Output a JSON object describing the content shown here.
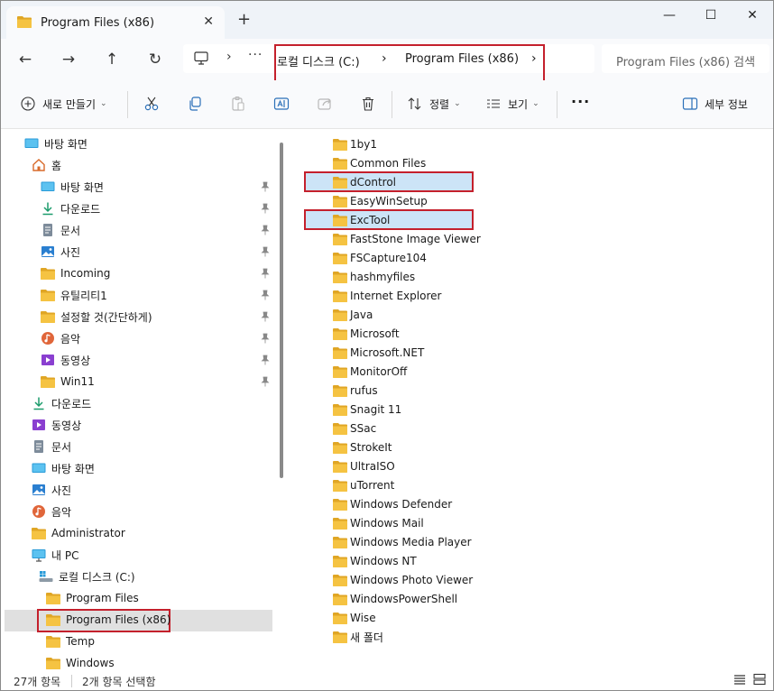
{
  "window": {
    "tab_title": "Program Files (x86)",
    "tab_close": "✕",
    "new_tab": "+",
    "minimize": "—",
    "maximize": "☐",
    "close": "✕"
  },
  "address": {
    "back": "←",
    "forward": "→",
    "up": "↑",
    "refresh": "↻",
    "sep": "›",
    "more": "···",
    "crumbs": [
      "로컬 디스크 (C:)",
      "Program Files (x86)"
    ],
    "search_placeholder": "Program Files (x86) 검색"
  },
  "toolbar": {
    "new_label": "새로 만들기",
    "sort_label": "정렬",
    "view_label": "보기",
    "more": "···",
    "details_label": "세부 정보",
    "icons": [
      "cut-icon",
      "copy-icon",
      "paste-icon",
      "rename-icon",
      "share-icon",
      "delete-icon"
    ]
  },
  "sidebar": {
    "items": [
      {
        "label": "바탕 화면",
        "icon": "desktop-icon"
      },
      {
        "label": "홈",
        "icon": "home-icon"
      },
      {
        "label": "바탕 화면",
        "icon": "desktop-icon",
        "pinned": true
      },
      {
        "label": "다운로드",
        "icon": "download-icon",
        "pinned": true
      },
      {
        "label": "문서",
        "icon": "document-icon",
        "pinned": true
      },
      {
        "label": "사진",
        "icon": "picture-icon",
        "pinned": true
      },
      {
        "label": "Incoming",
        "icon": "folder-icon",
        "pinned": true
      },
      {
        "label": "유틸리티1",
        "icon": "folder-icon",
        "pinned": true
      },
      {
        "label": "설정할 것(간단하게)",
        "icon": "folder-icon",
        "pinned": true
      },
      {
        "label": "음악",
        "icon": "music-icon",
        "pinned": true
      },
      {
        "label": "동영상",
        "icon": "video-icon",
        "pinned": true
      },
      {
        "label": "Win11",
        "icon": "folder-icon",
        "pinned": true
      },
      {
        "label": "다운로드",
        "icon": "download-icon"
      },
      {
        "label": "동영상",
        "icon": "video-icon"
      },
      {
        "label": "문서",
        "icon": "document-icon"
      },
      {
        "label": "바탕 화면",
        "icon": "desktop-icon"
      },
      {
        "label": "사진",
        "icon": "picture-icon"
      },
      {
        "label": "음악",
        "icon": "music-icon"
      },
      {
        "label": "Administrator",
        "icon": "folder-icon"
      },
      {
        "label": "내 PC",
        "icon": "pc-icon"
      },
      {
        "label": "로컬 디스크 (C:)",
        "icon": "drive-icon"
      },
      {
        "label": "Program Files",
        "icon": "folder-icon"
      },
      {
        "label": "Program Files (x86)",
        "icon": "folder-icon",
        "selected": true
      },
      {
        "label": "Temp",
        "icon": "folder-icon"
      },
      {
        "label": "Windows",
        "icon": "folder-icon"
      }
    ]
  },
  "files": [
    "1by1",
    "Common Files",
    "dControl",
    "EasyWinSetup",
    "ExcTool",
    "FastStone Image Viewer",
    "FSCapture104",
    "hashmyfiles",
    "Internet Explorer",
    "Java",
    "Microsoft",
    "Microsoft.NET",
    "MonitorOff",
    "rufus",
    "Snagit 11",
    "SSac",
    "StrokeIt",
    "UltraISO",
    "uTorrent",
    "Windows Defender",
    "Windows Mail",
    "Windows Media Player",
    "Windows NT",
    "Windows Photo Viewer",
    "WindowsPowerShell",
    "Wise",
    "새 폴더"
  ],
  "selected_files": [
    "dControl",
    "ExcTool"
  ],
  "status": {
    "count": "27개 항목",
    "selection": "2개 항목 선택함"
  },
  "colors": {
    "folder": "#f5c342",
    "folder_dark": "#e0a625",
    "highlight_border": "#c4202c",
    "selected_bg": "#cce4f7"
  }
}
